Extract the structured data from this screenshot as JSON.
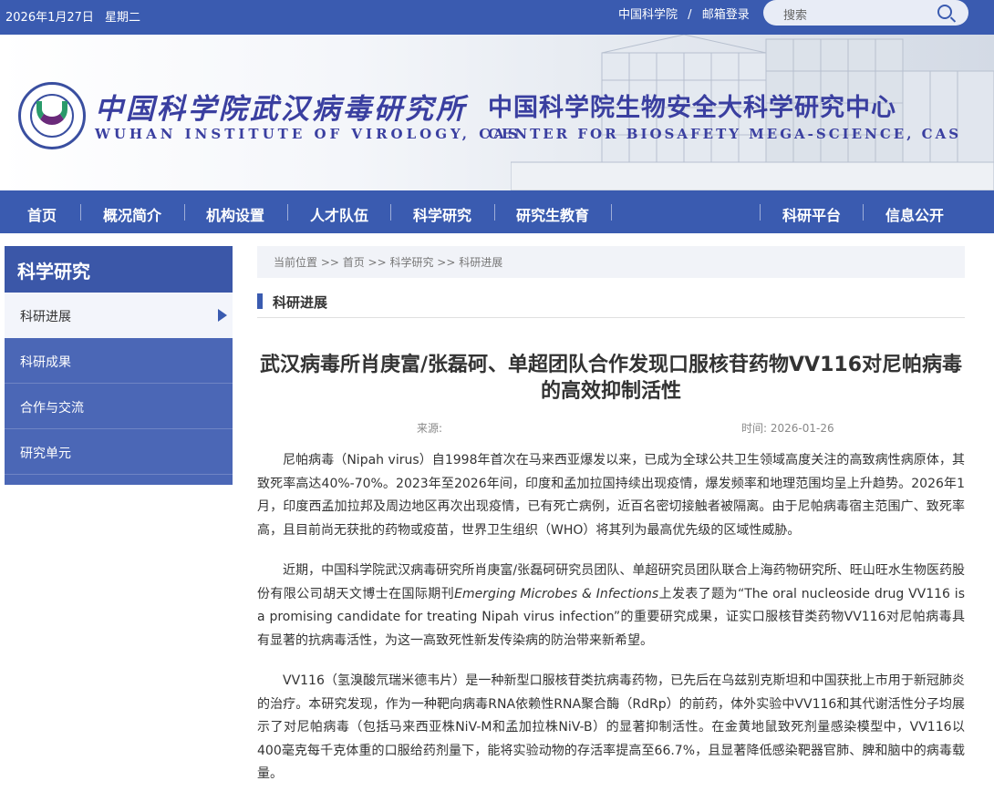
{
  "topbar": {
    "date": "2026年1月27日",
    "weekday": "星期二",
    "link_cas": "中国科学院",
    "link_sep": "/",
    "link_mail": "邮箱登录",
    "search_placeholder": "搜索"
  },
  "banner": {
    "org_cn": "中国科学院武汉病毒研究所",
    "org_en": "WUHAN INSTITUTE OF VIROLOGY, CAS",
    "center_cn": "中国科学院生物安全大科学研究中心",
    "center_en": "CENTER FOR BIOSAFETY MEGA-SCIENCE, CAS"
  },
  "nav": {
    "items": [
      "首页",
      "概况简介",
      "机构设置",
      "人才队伍",
      "科学研究",
      "研究生教育",
      "科研平台",
      "信息公开"
    ]
  },
  "sidebar": {
    "title": "科学研究",
    "items": [
      "科研进展",
      "科研成果",
      "合作与交流",
      "研究单元"
    ]
  },
  "breadcrumb": "当前位置 >>  首页 >> 科学研究 >> 科研进展",
  "section": "科研进展",
  "article": {
    "title": "武汉病毒所肖庚富/张磊砢、单超团队合作发现口服核苷药物VV116对尼帕病毒的高效抑制活性",
    "source_label": "来源:",
    "time_label": "时间: 2026-01-26",
    "p1": "尼帕病毒（Nipah virus）自1998年首次在马来西亚爆发以来，已成为全球公共卫生领域高度关注的高致病性病原体，其致死率高达40%-70%。2023年至2026年间，印度和孟加拉国持续出现疫情，爆发频率和地理范围均呈上升趋势。2026年1月，印度西孟加拉邦及周边地区再次出现疫情，已有死亡病例，近百名密切接触者被隔离。由于尼帕病毒宿主范围广、致死率高，且目前尚无获批的药物或疫苗，世界卫生组织（WHO）将其列为最高优先级的区域性威胁。",
    "p2_a": "近期，中国科学院武汉病毒研究所肖庚富/张磊砢研究员团队、单超研究员团队联合上海药物研究所、旺山旺水生物医药股份有限公司胡天文博士在国际期刊",
    "p2_journal": "Emerging Microbes & Infections",
    "p2_b": "上发表了题为“The oral nucleoside drug VV116 is a promising candidate for treating Nipah virus infection”的重要研究成果，证实口服核苷类药物VV116对尼帕病毒具有显著的抗病毒活性，为这一高致死性新发传染病的防治带来新希望。",
    "p3": "VV116（氢溴酸氘瑞米德韦片）是一种新型口服核苷类抗病毒药物，已先后在乌兹别克斯坦和中国获批上市用于新冠肺炎的治疗。本研究发现，作为一种靶向病毒RNA依赖性RNA聚合酶（RdRp）的前药，体外实验中VV116和其代谢活性分子均展示了对尼帕病毒（包括马来西亚株NiV-M和孟加拉株NiV-B）的显著抑制活性。在金黄地鼠致死剂量感染模型中，VV116以400毫克每千克体重的口服给药剂量下，能将实验动物的存活率提高至66.7%，且显著降低感染靶器官肺、脾和脑中的病毒载量。"
  }
}
